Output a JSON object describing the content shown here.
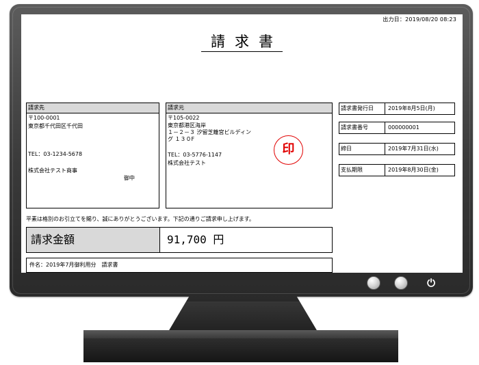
{
  "invoice": {
    "output_date": "出力日：2019/08/20 08:23",
    "title": "請求書",
    "billing_to": {
      "header": "請求先",
      "postal": "〒100-0001",
      "address": "東京都千代田区千代田",
      "tel": "TEL：03-1234-5678",
      "company": "株式会社テスト商事",
      "honorific": "御中"
    },
    "billing_from": {
      "header": "請求元",
      "postal": "〒105-0022",
      "address_line1": "東京都港区海岸",
      "address_line2": "１－２－３ 汐留芝離宮ビルディン",
      "address_line3": "グ １３０F",
      "tel": "TEL：03-5776-1147",
      "company": "株式会社テスト",
      "seal": "印"
    },
    "details": [
      {
        "label": "請求書発行日",
        "value": "2019年8月5日(月)"
      },
      {
        "label": "請求書番号",
        "value": "000000001"
      },
      {
        "label": "締日",
        "value": "2019年7月31日(水)"
      },
      {
        "label": "支払期限",
        "value": "2019年8月30日(金)"
      }
    ],
    "greeting": "平素は格別のお引立てを賜り、誠にありがとうございます。下記の通りご請求申し上げます。",
    "amount_label": "請求金額",
    "amount_value": "91,700 円",
    "subject": "件名：2019年7月御利用分　請求書"
  },
  "monitor": {
    "buttons": [
      {
        "icon": "circle-button"
      },
      {
        "icon": "circle-button"
      },
      {
        "icon": "power-icon",
        "glyph": "⏻"
      }
    ]
  }
}
